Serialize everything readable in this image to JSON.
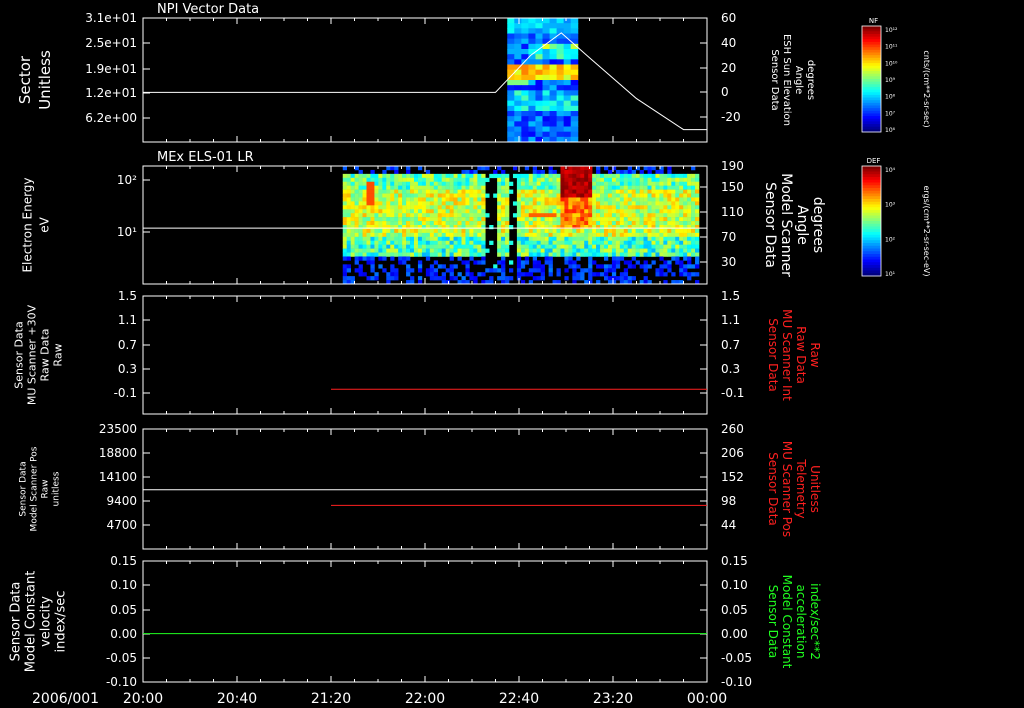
{
  "colors": {
    "background": "#000000",
    "frame": "#ffffff",
    "red_trace": "#ff2020",
    "green_trace": "#20ff20",
    "white_trace": "#ffffff"
  },
  "footer": {
    "date_label": "2006/001",
    "time_ticks": [
      "20:00",
      "20:40",
      "21:20",
      "22:00",
      "22:40",
      "23:20",
      "00:00"
    ]
  },
  "colorbars": [
    {
      "tag": "NF",
      "unit_label": "cnts/(cm**2-sr-sec)",
      "tick_labels": [
        "10¹²",
        "10¹¹",
        "10¹⁰",
        "10⁹",
        "10⁸",
        "10⁷",
        "10⁶"
      ]
    },
    {
      "tag": "DEF",
      "unit_label": "ergs/(cm**2-sr-sec-eV)",
      "tick_labels": [
        "10⁴",
        "10³",
        "10²",
        "10¹"
      ]
    }
  ],
  "chart_data": [
    {
      "type": "heatmap",
      "title": "NPI Vector Data",
      "left_axis": {
        "label_lines": [
          "Sector",
          "Unitless"
        ],
        "tick_labels": [
          "3.1e+01",
          "2.5e+01",
          "1.9e+01",
          "1.2e+01",
          "6.2e+00"
        ],
        "ylim": [
          0,
          31
        ]
      },
      "right_axis": {
        "label_lines": [
          "Sensor Data",
          "ESH Sun Elevation",
          "Angle",
          "degrees"
        ],
        "tick_labels": [
          "60",
          "40",
          "20",
          "0",
          "-20"
        ],
        "ylim": [
          -40,
          60
        ]
      },
      "x_range": [
        "20:00",
        "00:00"
      ],
      "heatmap_band": {
        "start": "22:35",
        "end": "23:05",
        "colorbar": "NF"
      },
      "series": [
        {
          "axis": "right",
          "color": "white",
          "x": [
            "20:00",
            "22:30",
            "22:45",
            "22:58",
            "23:10",
            "23:30",
            "23:50",
            "00:00"
          ],
          "y": [
            0,
            0,
            30,
            48,
            28,
            -5,
            -30,
            -30
          ]
        }
      ]
    },
    {
      "type": "heatmap",
      "title": "MEx ELS-01 LR",
      "left_axis": {
        "label_lines": [
          "Electron Energy",
          "eV"
        ],
        "tick_labels": [
          "10²",
          "10¹"
        ],
        "scale": "log",
        "ylim": [
          1.3,
          200
        ]
      },
      "right_axis": {
        "label_lines": [
          "Sensor Data",
          "Model Scanner",
          "Angle",
          "degrees"
        ],
        "tick_labels": [
          "190",
          "150",
          "110",
          "70",
          "30"
        ],
        "ylim": [
          0,
          190
        ]
      },
      "x_range": [
        "20:00",
        "00:00"
      ],
      "heatmap_band": {
        "start": "21:25",
        "end": "00:00",
        "colorbar": "DEF"
      },
      "series": [
        {
          "axis": "right",
          "color": "white",
          "x": [
            "20:00",
            "00:00"
          ],
          "y": [
            90,
            90
          ]
        }
      ]
    },
    {
      "type": "line",
      "left_axis": {
        "label_lines": [
          "Sensor Data",
          "MU Scanner +30V",
          "Raw Data",
          "Raw"
        ],
        "tick_labels": [
          "1.5",
          "1.1",
          "0.7",
          "0.3",
          "-0.1"
        ],
        "ylim": [
          -0.4,
          1.5
        ]
      },
      "right_axis": {
        "label_lines": [
          "Sensor Data",
          "MU Scanner Int",
          "Raw Data",
          "Raw"
        ],
        "tick_labels": [
          "1.5",
          "1.1",
          "0.7",
          "0.3",
          "-0.1"
        ],
        "ylim": [
          -0.4,
          1.5
        ]
      },
      "x_range": [
        "20:00",
        "00:00"
      ],
      "series": [
        {
          "axis": "right",
          "color": "red",
          "x": [
            "21:20",
            "00:00"
          ],
          "y": [
            0.0,
            0.0
          ]
        }
      ]
    },
    {
      "type": "line",
      "left_axis": {
        "label_lines": [
          "Sensor Data",
          "Model Scanner Pos",
          "Raw",
          "unitless"
        ],
        "tick_labels": [
          "23500",
          "18800",
          "14100",
          "9400",
          "4700"
        ],
        "ylim": [
          0,
          23500
        ]
      },
      "right_axis": {
        "label_lines": [
          "Sensor Data",
          "MU Scanner Pos",
          "Telemetry",
          "Unitless"
        ],
        "tick_labels": [
          "260",
          "206",
          "152",
          "98",
          "44"
        ],
        "ylim": [
          -10,
          260
        ]
      },
      "x_range": [
        "20:00",
        "00:00"
      ],
      "series": [
        {
          "axis": "left",
          "color": "white",
          "x": [
            "20:00",
            "00:00"
          ],
          "y": [
            11600,
            11600
          ]
        },
        {
          "axis": "right",
          "color": "red",
          "x": [
            "21:20",
            "00:00"
          ],
          "y": [
            88,
            88
          ]
        }
      ]
    },
    {
      "type": "line",
      "left_axis": {
        "label_lines": [
          "Sensor Data",
          "Model Constant",
          "velocity",
          "index/sec"
        ],
        "tick_labels": [
          "0.15",
          "0.10",
          "0.05",
          "0.00",
          "-0.05",
          "-0.10"
        ],
        "ylim": [
          -0.1,
          0.15
        ]
      },
      "right_axis": {
        "label_lines": [
          "Sensor Data",
          "Model Constant",
          "acceleration",
          "index/sec**2"
        ],
        "tick_labels": [
          "0.15",
          "0.10",
          "0.05",
          "0.00",
          "-0.05",
          "-0.10"
        ],
        "ylim": [
          -0.1,
          0.15
        ]
      },
      "x_range": [
        "20:00",
        "00:00"
      ],
      "series": [
        {
          "axis": "left",
          "color": "green",
          "x": [
            "20:00",
            "00:00"
          ],
          "y": [
            0.0,
            0.0
          ]
        }
      ]
    }
  ]
}
